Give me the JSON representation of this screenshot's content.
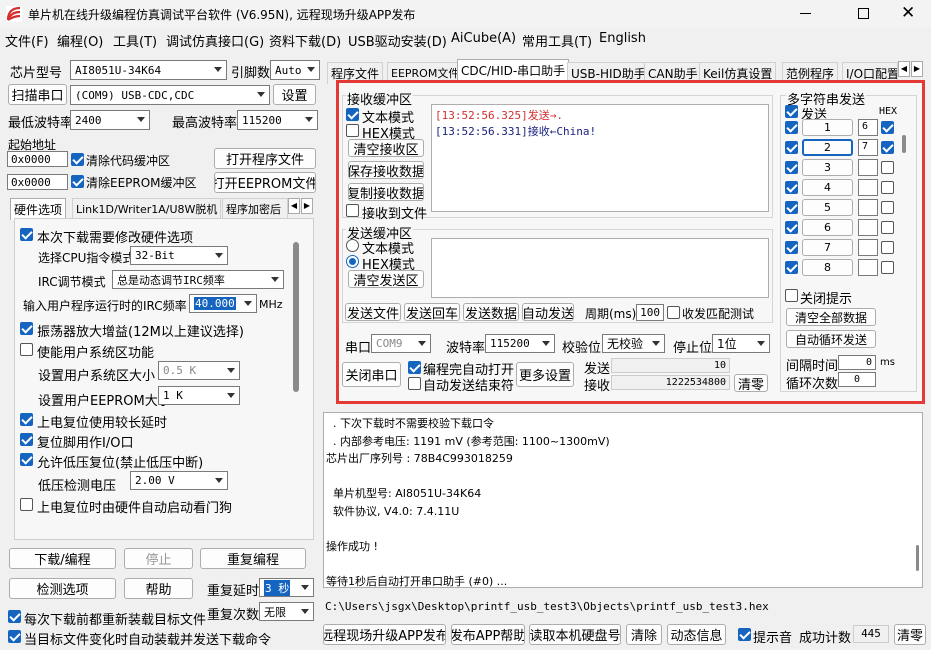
{
  "title": "单片机在线升级编程仿真调试平台软件 (V6.95N), 远程现场升级APP发布",
  "menu": [
    "文件(F)",
    "编程(O)",
    "工具(T)",
    "调试仿真接口(G)",
    "资料下载(D)",
    "USB驱动安装(D)",
    "AiCube(A)",
    "常用工具(T)",
    "English"
  ],
  "left": {
    "chip_label": "芯片型号",
    "chip_value": "AI8051U-34K64",
    "pin_label": "引脚数",
    "pin_value": "Auto",
    "scan_btn": "扫描串口",
    "port_value": "(COM9) USB-CDC,CDC",
    "settings_btn": "设置",
    "min_baud_label": "最低波特率",
    "min_baud": "2400",
    "max_baud_label": "最高波特率",
    "max_baud": "115200",
    "start_addr_label": "起始地址",
    "addr1": "0x0000",
    "addr2": "0x0000",
    "clear_code": "清除代码缓冲区",
    "clear_eeprom": "清除EEPROM缓冲区",
    "open_prog": "打开程序文件",
    "open_eeprom": "打开EEPROM文件",
    "tabs": [
      "硬件选项",
      "Link1D/Writer1A/U8W脱机",
      "程序加密后"
    ],
    "hw": {
      "modify": "本次下载需要修改硬件选项",
      "cpu_label": "选择CPU指令模式",
      "cpu_value": "32-Bit",
      "irc_label": "IRC调节模式",
      "irc_value": "总是动态调节IRC频率",
      "freq_label": "输入用户程序运行时的IRC频率",
      "freq_value": "40.000",
      "freq_unit": "MHz",
      "osc": "振荡器放大增益(12M以上建议选择)",
      "sys_area": "使能用户系统区功能",
      "sys_size_label": "设置用户系统区大小",
      "sys_size": "0.5 K",
      "eeprom_size_label": "设置用户EEPROM大小",
      "eeprom_size": "1   K",
      "long_delay": "上电复位使用较长延时",
      "reset_io": "复位脚用作I/O口",
      "lvr": "允许低压复位(禁止低压中断)",
      "lvd_label": "低压检测电压",
      "lvd_value": "2.00 V",
      "watchdog": "上电复位时由硬件自动启动看门狗"
    },
    "download_btn": "下载/编程",
    "stop_btn": "停止",
    "reprog_btn": "重复编程",
    "detect_btn": "检测选项",
    "help_btn": "帮助",
    "repeat_delay_label": "重复延时",
    "repeat_delay": "3 秒",
    "repeat_count_label": "重复次数",
    "repeat_count": "无限",
    "reload_each": "每次下载前都重新装载目标文件",
    "auto_reload": "当目标文件变化时自动装载并发送下载命令"
  },
  "right_tabs": [
    "程序文件",
    "EEPROM文件",
    "CDC/HID-串口助手",
    "USB-HID助手",
    "CAN助手",
    "Keil仿真设置",
    "范例程序",
    "I/O口配置"
  ],
  "serial": {
    "recv_title": "接收缓冲区",
    "text_mode": "文本模式",
    "hex_mode": "HEX模式",
    "clear_recv": "清空接收区",
    "save_recv": "保存接收数据",
    "copy_recv": "复制接收数据",
    "recv_to_file": "接收到文件",
    "recv_lines": [
      {
        "text": "[13:52:56.325]发送→.",
        "color": "#d32f2f"
      },
      {
        "text": "[13:52:56.331]接收←China!",
        "color": "#1a237e"
      }
    ],
    "send_title": "发送缓冲区",
    "send_text_mode": "文本模式",
    "send_hex_mode": "HEX模式",
    "clear_send": "清空发送区",
    "send_file": "发送文件",
    "send_return": "发送回车",
    "send_data": "发送数据",
    "auto_send": "自动发送",
    "period_label": "周期(ms)",
    "period": "100",
    "match_label": "收发匹配测试",
    "port_label": "串口",
    "port": "COM9",
    "baud_label": "波特率",
    "baud": "115200",
    "parity_label": "校验位",
    "parity": "无校验",
    "stop_label": "停止位",
    "stop": "1位",
    "close_port": "关闭串口",
    "auto_open": "编程完自动打开",
    "auto_send_end": "自动发送结束符",
    "more": "更多设置",
    "send_count_label": "发送",
    "send_count": "10",
    "recv_count_label": "接收",
    "recv_count": "1222534800",
    "clear_count": "清零",
    "multi_title": "多字符串发送",
    "send_col": "发送",
    "hex_col": "HEX",
    "multi_rows": [
      {
        "n": "1",
        "v": "6",
        "c": true,
        "h": true
      },
      {
        "n": "2",
        "v": "7",
        "c": true,
        "h": true
      },
      {
        "n": "3",
        "v": "",
        "c": true,
        "h": false
      },
      {
        "n": "4",
        "v": "",
        "c": true,
        "h": false
      },
      {
        "n": "5",
        "v": "",
        "c": true,
        "h": false
      },
      {
        "n": "6",
        "v": "",
        "c": true,
        "h": false
      },
      {
        "n": "7",
        "v": "",
        "c": true,
        "h": false
      },
      {
        "n": "8",
        "v": "",
        "c": true,
        "h": false
      }
    ],
    "close_tip": "关闭提示",
    "clear_all": "清空全部数据",
    "auto_cycle": "自动循环发送",
    "interval_label": "间隔时间",
    "interval": "0",
    "interval_unit": "ms",
    "cycle_label": "循环次数",
    "cycle": "0"
  },
  "log_lines": [
    "  . 下次下载时不需要校验下载口令",
    "  . 内部参考电压: 1191 mV (参考范围: 1100~1300mV)",
    "芯片出厂序列号 : 78B4C993018259",
    "",
    "  单片机型号: AI8051U-34K64",
    "  软件协议, V4.0: 7.4.11U",
    "",
    "操作成功 !",
    "",
    "等待1秒后自动打开串口助手 (#0) ..."
  ],
  "path": "C:\\Users\\jsgx\\Desktop\\printf_usb_test3\\Objects\\printf_usb_test3.hex",
  "bottom": {
    "remote": "远程现场升级APP发布",
    "publish_help": "发布APP帮助",
    "read_disk": "读取本机硬盘号",
    "clear": "清除",
    "anim": "动态信息",
    "beep": "提示音",
    "success_label": "成功计数",
    "success_count": "445",
    "clear2": "清零"
  },
  "colors": {
    "highlight": "#e53935",
    "accent": "#1565c0"
  }
}
